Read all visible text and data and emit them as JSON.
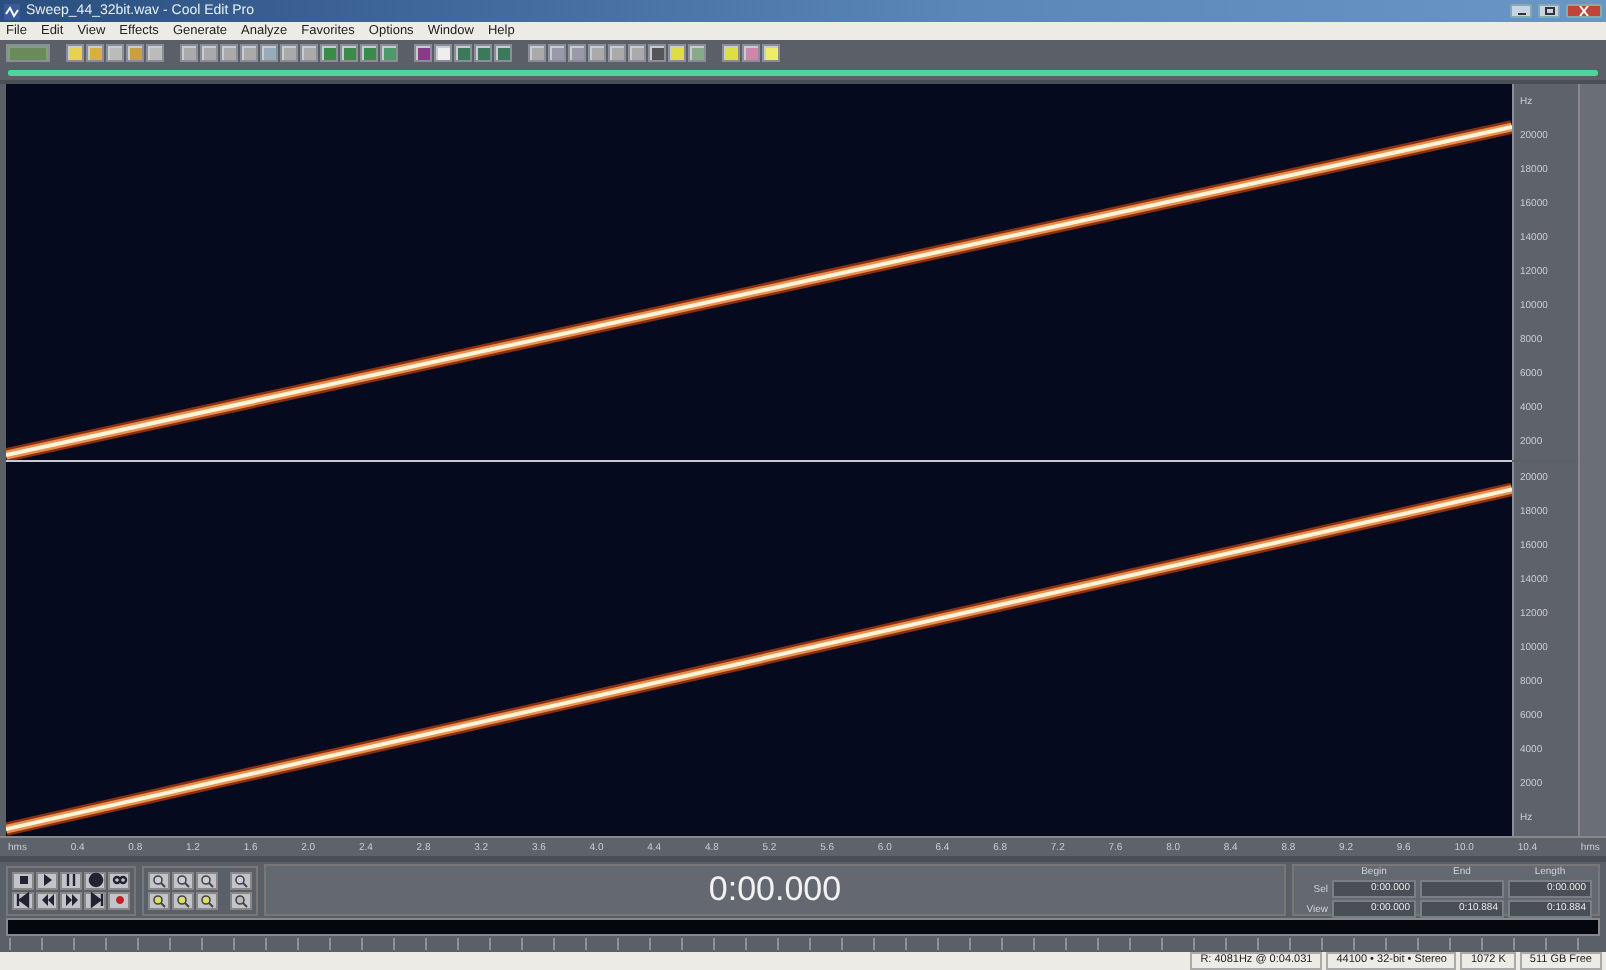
{
  "window": {
    "title": "Sweep_44_32bit.wav - Cool Edit Pro"
  },
  "progress": {
    "level": 1
  },
  "menu": [
    "File",
    "Edit",
    "View",
    "Effects",
    "Generate",
    "Analyze",
    "Favorites",
    "Options",
    "Window",
    "Help"
  ],
  "channels": [
    {
      "axis_labels": [
        "Hz",
        "20000",
        "18000",
        "16000",
        "14000",
        "12000",
        "10000",
        "8000",
        "6000",
        "4000",
        "2000"
      ]
    },
    {
      "axis_labels": [
        "20000",
        "18000",
        "16000",
        "14000",
        "12000",
        "10000",
        "8000",
        "6000",
        "4000",
        "2000",
        "Hz"
      ]
    }
  ],
  "time_ruler": {
    "labels": [
      "hms",
      "0.4",
      "0.8",
      "1.2",
      "1.6",
      "2.0",
      "2.4",
      "2.8",
      "3.2",
      "3.6",
      "4.0",
      "4.4",
      "4.8",
      "5.2",
      "5.6",
      "6.0",
      "6.4",
      "6.8",
      "7.2",
      "7.6",
      "8.0",
      "8.4",
      "8.8",
      "9.2",
      "9.6",
      "10.0",
      "10.4",
      "hms"
    ]
  },
  "time_display": "0:00.000",
  "selection": {
    "headers": [
      "Begin",
      "End",
      "Length"
    ],
    "rows": [
      {
        "label": "Sel",
        "begin": "0:00.000",
        "length": "0:00.000"
      },
      {
        "label": "View",
        "begin": "0:00.000",
        "end": "0:10.884",
        "length": "0:10.884"
      }
    ]
  },
  "status_bar": [
    "R: 4081Hz @ 0:04.031",
    "44100 • 32-bit • Stereo",
    "1072 K",
    "511 GB Free"
  ]
}
